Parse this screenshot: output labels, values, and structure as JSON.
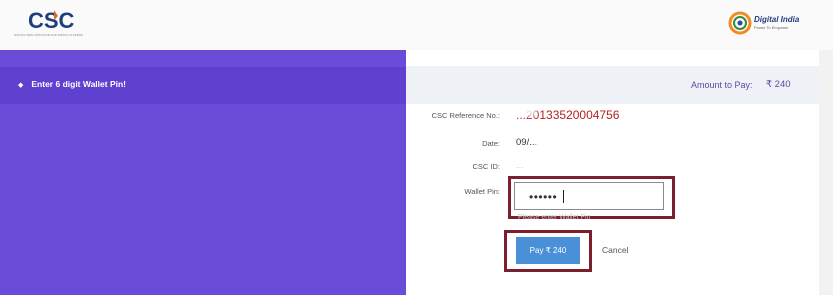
{
  "header": {
    "csc_logo_text": "CSC",
    "csc_tagline": "DIGITAL INDIA INITIATIVE FOR INDIA'S CITIZENS",
    "digital_india_title": "Digital India",
    "digital_india_tagline": "Power To Empower"
  },
  "left_panel": {
    "message": "Enter 6 digit Wallet Pin!",
    "bullet_icon": "diamond-icon"
  },
  "right_panel": {
    "amount_label": "Amount to Pay:",
    "amount_value": "₹ 240",
    "fields": {
      "reference_label": "CSC Reference No.:",
      "reference_value": "...20133520004756",
      "date_label": "Date:",
      "date_value": "09/...",
      "csc_id_label": "CSC ID:",
      "csc_id_value": "...",
      "wallet_pin_label": "Wallet Pin:",
      "wallet_pin_value": "••••••",
      "wallet_pin_hint": "Please enter Wallet Pin"
    },
    "pay_button": "Pay  ₹ 240",
    "cancel_link": "Cancel"
  },
  "colors": {
    "left_panel": "#6a4cd8",
    "left_band": "#5f40cf",
    "accent_text": "#5a4aa8",
    "reference_red": "#b22222",
    "pay_button": "#4a90d9",
    "highlight_border": "#7a1f2b"
  }
}
